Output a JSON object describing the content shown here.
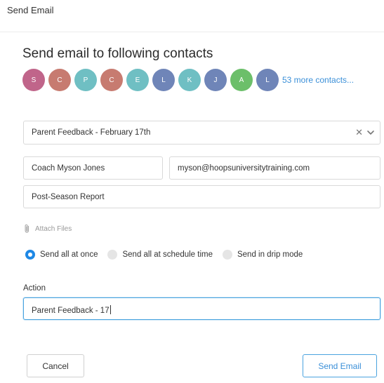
{
  "window": {
    "title": "Send Email"
  },
  "heading": "Send email to following contacts",
  "contacts": [
    {
      "initial": "S",
      "color": "#c0658a"
    },
    {
      "initial": "C",
      "color": "#c77b70"
    },
    {
      "initial": "P",
      "color": "#6fbfc3"
    },
    {
      "initial": "C",
      "color": "#c77b70"
    },
    {
      "initial": "E",
      "color": "#6fbfc3"
    },
    {
      "initial": "L",
      "color": "#6f85b8"
    },
    {
      "initial": "K",
      "color": "#6fbfc3"
    },
    {
      "initial": "J",
      "color": "#6f85b8"
    },
    {
      "initial": "A",
      "color": "#6cbf6a"
    },
    {
      "initial": "L",
      "color": "#6f85b8"
    }
  ],
  "more_contacts": "53 more contacts...",
  "template_select": {
    "value": "Parent Feedback - February 17th",
    "clear": "✕"
  },
  "from_name": "Coach Myson Jones",
  "from_email": "myson@hoopsuniversitytraining.com",
  "subject": "Post-Season Report",
  "attach_label": "Attach Files",
  "send_modes": [
    {
      "label": "Send all at once",
      "selected": true
    },
    {
      "label": "Send all at schedule time",
      "selected": false
    },
    {
      "label": "Send in drip mode",
      "selected": false
    }
  ],
  "action": {
    "label": "Action",
    "value": "Parent Feedback - 17"
  },
  "buttons": {
    "cancel": "Cancel",
    "send": "Send Email"
  },
  "colors": {
    "accent": "#1e88e5",
    "link": "#3a8fd8",
    "focus": "#4aa3df"
  }
}
